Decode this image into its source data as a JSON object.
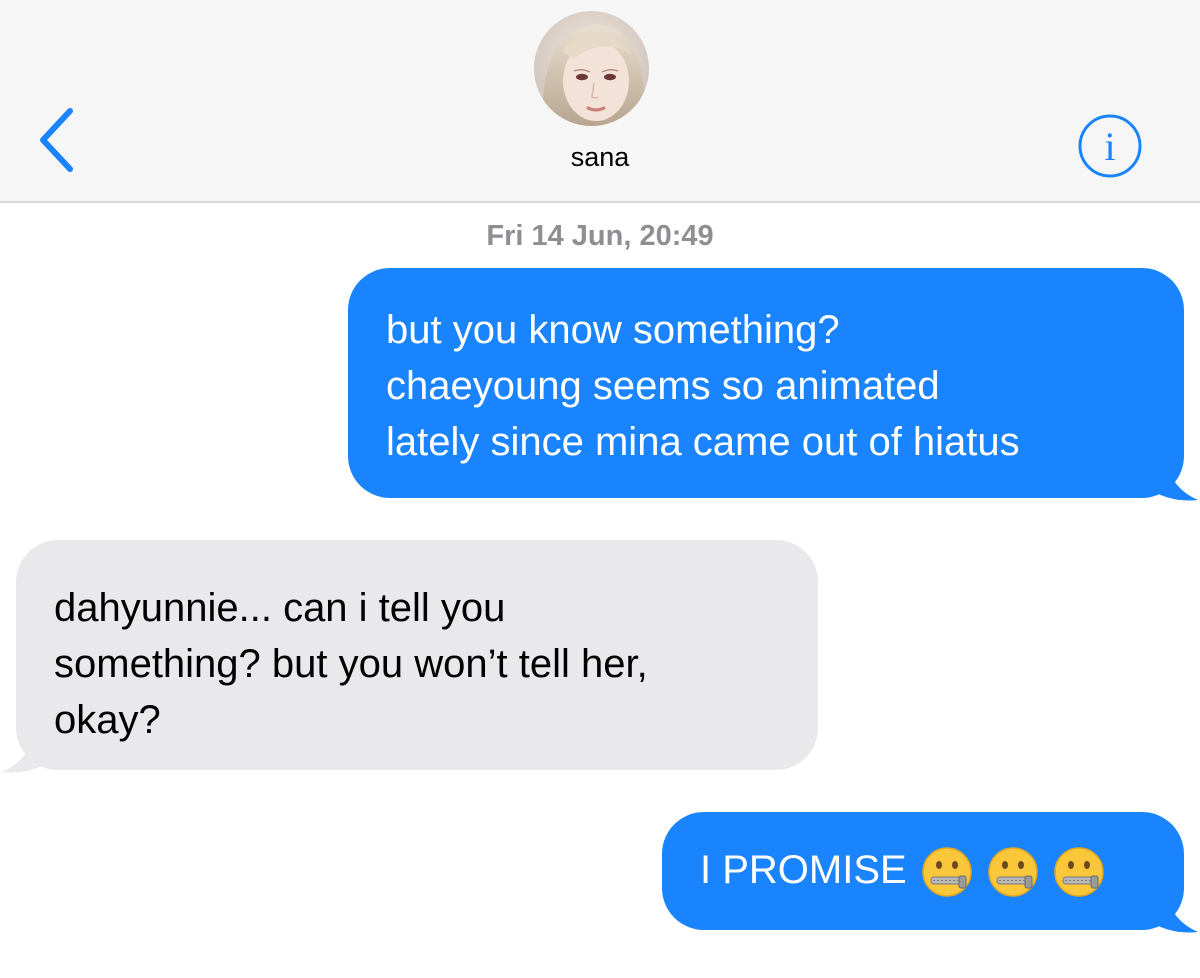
{
  "header": {
    "contact_name": "sana",
    "back_icon": "chevron-left-icon",
    "info_icon": "info-icon",
    "accent_color": "#1a84ff"
  },
  "conversation": {
    "timestamp": "Fri 14 Jun, 20:49",
    "messages": [
      {
        "direction": "sent",
        "lines": [
          "but you know something?",
          "chaeyoung seems so animated",
          "lately since mina came out of hiatus"
        ]
      },
      {
        "direction": "received",
        "lines": [
          "dahyunnie... can i tell you",
          "something? but you won’t tell her,",
          "okay?"
        ]
      },
      {
        "direction": "sent",
        "text": "I PROMISE",
        "emojis": [
          "zipper-mouth-face",
          "zipper-mouth-face",
          "zipper-mouth-face"
        ]
      }
    ]
  },
  "colors": {
    "sent_bubble": "#1a84ff",
    "received_bubble": "#e9e9eb",
    "header_bg": "#f6f6f6",
    "timestamp": "#8e8e93"
  }
}
